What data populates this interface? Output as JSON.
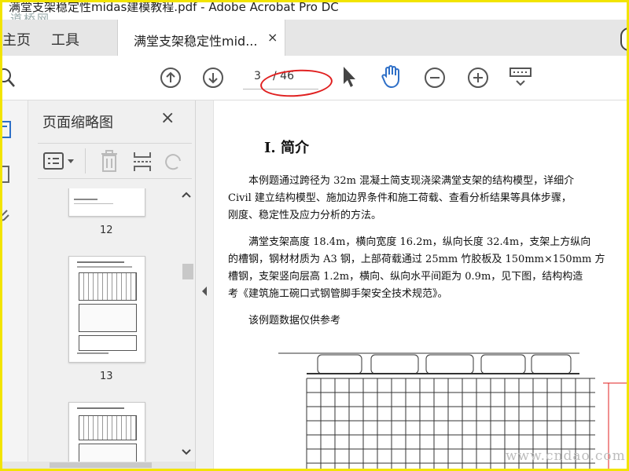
{
  "window": {
    "title": "满堂支架稳定性midas建模教程.pdf - Adobe Acrobat Pro DC",
    "watermark_top": "道桥网",
    "watermark_bottom": "www.cndao.com"
  },
  "tabs": {
    "home": "主页",
    "tools": "工具",
    "document": "满堂支架稳定性mid...",
    "close": "×"
  },
  "toolbar": {
    "current_page": "3",
    "total_pages": "/ 46",
    "icons": [
      "search-icon",
      "prev-page-icon",
      "next-page-icon",
      "select-arrow-icon",
      "hand-tool-icon",
      "zoom-out-icon",
      "zoom-in-icon",
      "keyboard-icon"
    ]
  },
  "sidebar": {
    "title": "页面缩略图",
    "close": "×",
    "thumbnails": [
      {
        "number": "12"
      },
      {
        "number": "13"
      },
      {
        "number": ""
      }
    ]
  },
  "document": {
    "heading": "I.  简介",
    "paragraphs": [
      [
        "　　本例题通过跨径为 32m 混凝土简支现浇梁满堂支架的结构模型，详细介",
        "Civil 建立结构模型、施加边界条件和施工荷载、查看分析结果等具体步骤，",
        "刚度、稳定性及应力分析的方法。"
      ],
      [
        "　　满堂支架高度 18.4m，横向宽度 16.2m，纵向长度 32.4m，支架上方纵向",
        "的槽钢，钢材材质为 A3 钢，上部荷载通过 25mm 竹胶板及 150mm×150mm 方",
        "槽钢，支架竖向层高 1.2m，横向、纵向水平间距为 0.9m，见下图，结构构造",
        "考《建筑施工碗口式钢管脚手架安全技术规范》。"
      ],
      [
        "　　该例题数据仅供参考"
      ]
    ]
  },
  "colors": {
    "accent_blue": "#2e6fc7",
    "highlight_oval": "#e02020",
    "frame_yellow": "#f2e400"
  }
}
